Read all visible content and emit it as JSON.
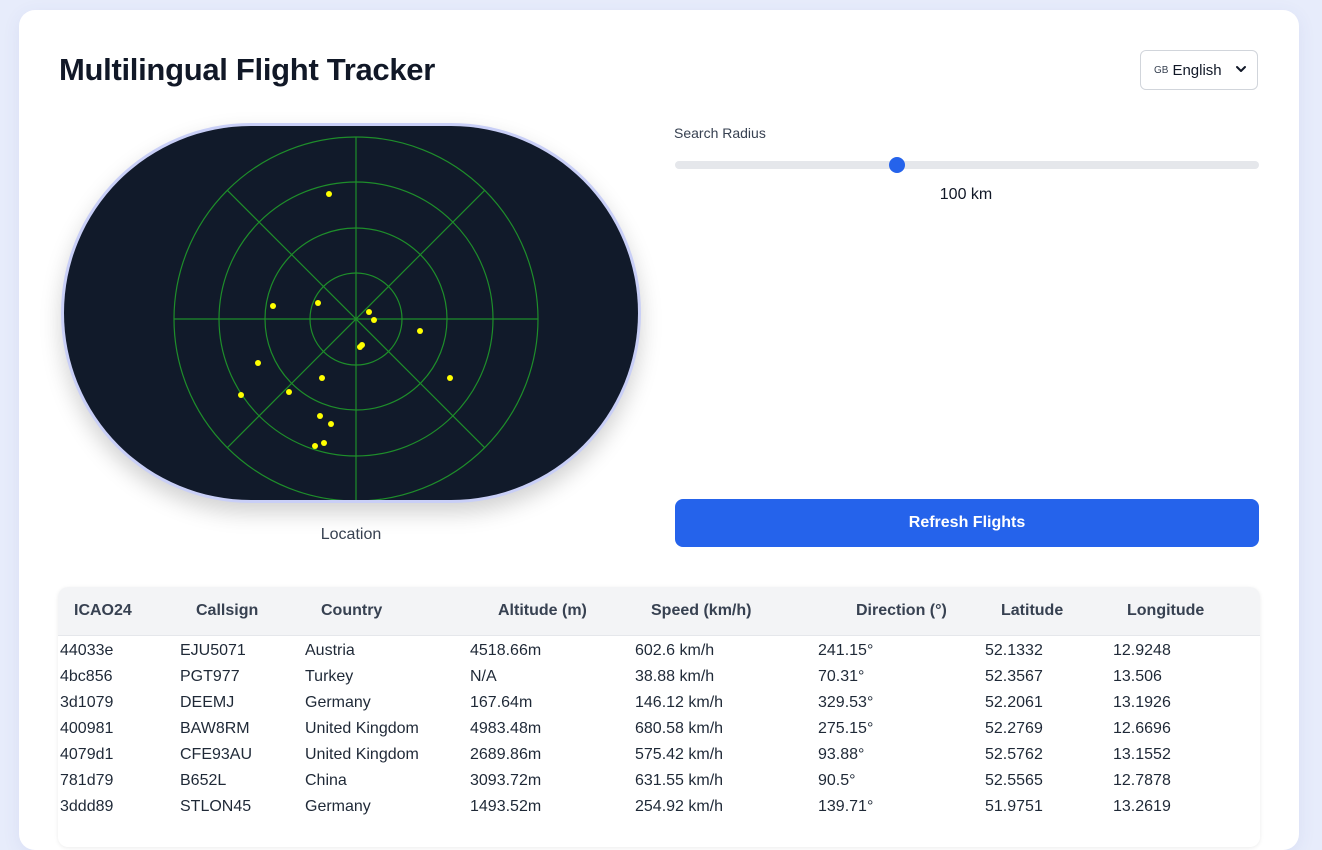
{
  "header": {
    "title": "Multilingual Flight Tracker",
    "language": {
      "flag": "GB",
      "selected": "English"
    }
  },
  "radar": {
    "location_label": "Location",
    "colors": {
      "background": "#111a2a",
      "grid": "#1e8e2a",
      "dot": "#ffff00",
      "border": "#c9cff7"
    }
  },
  "controls": {
    "radius_label": "Search Radius",
    "radius_value": "100 km",
    "slider_fraction": 0.38,
    "refresh_label": "Refresh Flights",
    "accent": "#2563eb"
  },
  "table": {
    "columns": [
      "ICAO24",
      "Callsign",
      "Country",
      "Altitude (m)",
      "Speed (km/h)",
      "Direction (°)",
      "Latitude",
      "Longitude"
    ],
    "rows": [
      [
        "44033e",
        "EJU5071",
        "Austria",
        "4518.66m",
        "602.6 km/h",
        "241.15°",
        "52.1332",
        "12.9248"
      ],
      [
        "4bc856",
        "PGT977",
        "Turkey",
        "N/A",
        "38.88 km/h",
        "70.31°",
        "52.3567",
        "13.506"
      ],
      [
        "3d1079",
        "DEEMJ",
        "Germany",
        "167.64m",
        "146.12 km/h",
        "329.53°",
        "52.2061",
        "13.1926"
      ],
      [
        "400981",
        "BAW8RM",
        "United Kingdom",
        "4983.48m",
        "680.58 km/h",
        "275.15°",
        "52.2769",
        "12.6696"
      ],
      [
        "4079d1",
        "CFE93AU",
        "United Kingdom",
        "2689.86m",
        "575.42 km/h",
        "93.88°",
        "52.5762",
        "13.1552"
      ],
      [
        "781d79",
        "B652L",
        "China",
        "3093.72m",
        "631.55 km/h",
        "90.5°",
        "52.5565",
        "12.7878"
      ],
      [
        "3ddd89",
        "STLON45",
        "Germany",
        "1493.52m",
        "254.92 km/h",
        "139.71°",
        "51.9751",
        "13.2619"
      ]
    ]
  }
}
